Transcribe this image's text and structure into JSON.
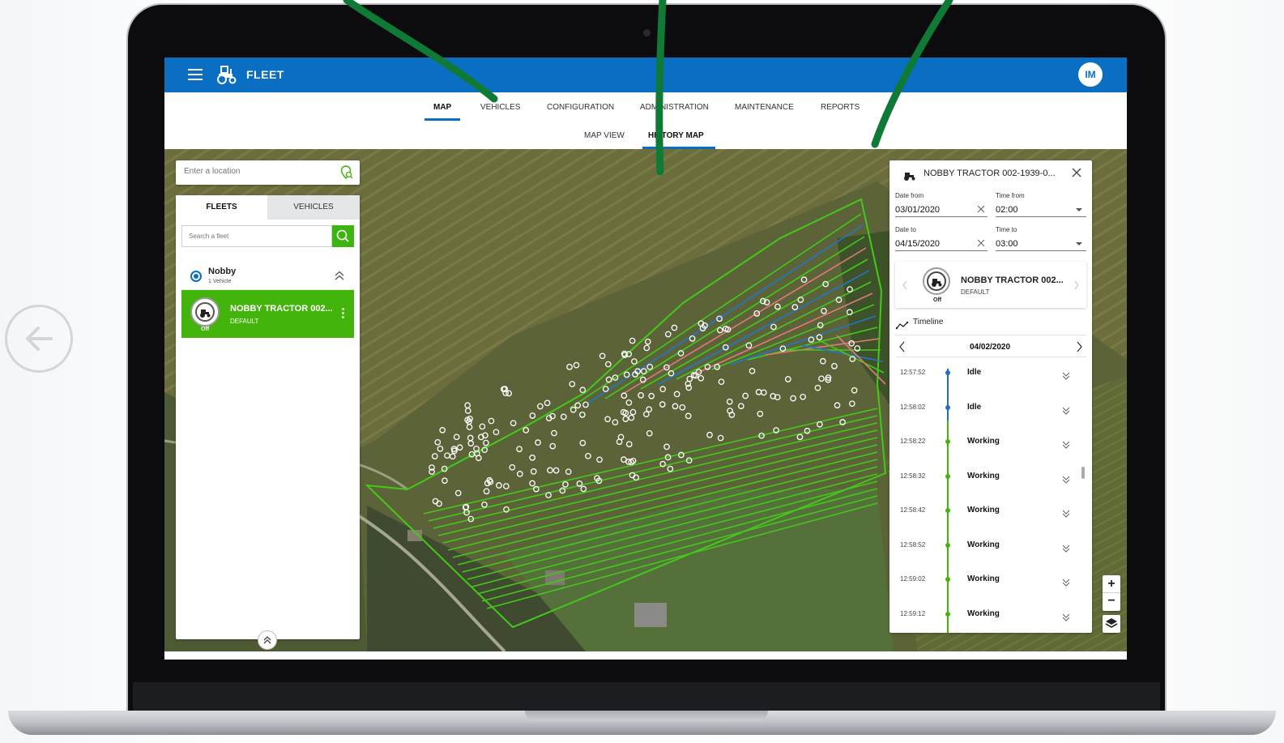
{
  "app": {
    "title": "FLEET",
    "user_initials": "IM",
    "brand_color": "#0a6fc2",
    "accent_green": "#43b40c"
  },
  "main_nav": {
    "items": [
      "MAP",
      "VEHICLES",
      "CONFIGURATION",
      "ADMINISTRATION",
      "MAINTENANCE",
      "REPORTS"
    ],
    "active": "MAP"
  },
  "sub_nav": {
    "items": [
      "MAP VIEW",
      "HISTORY MAP"
    ],
    "active": "HISTORY MAP"
  },
  "location_search": {
    "placeholder": "Enter a location"
  },
  "left_panel": {
    "tabs": [
      "FLEETS",
      "VEHICLES"
    ],
    "active_tab": "FLEETS",
    "search_placeholder": "Search a fleet",
    "fleet": {
      "name": "Nobby",
      "count": "1 Vehicle"
    },
    "vehicle": {
      "name": "NOBBY TRACTOR 002...",
      "group": "DEFAULT",
      "status": "Off"
    }
  },
  "right_panel": {
    "title": "NOBBY TRACTOR 002-1939-0...",
    "date_from_label": "Date from",
    "date_from": "03/01/2020",
    "time_from_label": "Time from",
    "time_from": "02:00",
    "date_to_label": "Date to",
    "date_to": "04/15/2020",
    "time_to_label": "Time to",
    "time_to": "03:00",
    "vehicle": {
      "name": "NOBBY TRACTOR 002...",
      "group": "DEFAULT",
      "status": "Off"
    },
    "timeline_label": "Timeline",
    "timeline_date": "04/02/2020",
    "entries": [
      {
        "time": "12:57:52",
        "status": "Idle",
        "color": "#1f6fc4"
      },
      {
        "time": "12:58:02",
        "status": "Idle",
        "color": "#1f6fc4"
      },
      {
        "time": "12:58:22",
        "status": "Working",
        "color": "#43b40c"
      },
      {
        "time": "12:58:32",
        "status": "Working",
        "color": "#43b40c"
      },
      {
        "time": "12:58:42",
        "status": "Working",
        "color": "#43b40c"
      },
      {
        "time": "12:58:52",
        "status": "Working",
        "color": "#43b40c"
      },
      {
        "time": "12:59:02",
        "status": "Working",
        "color": "#43b40c"
      },
      {
        "time": "12:59:12",
        "status": "Working",
        "color": "#43b40c"
      }
    ]
  },
  "map_controls": {
    "zoom_in": "+",
    "zoom_out": "−"
  },
  "track_colors": {
    "working": "#43c91a",
    "idle": "#1f78c8",
    "other": "#e07a7a"
  }
}
